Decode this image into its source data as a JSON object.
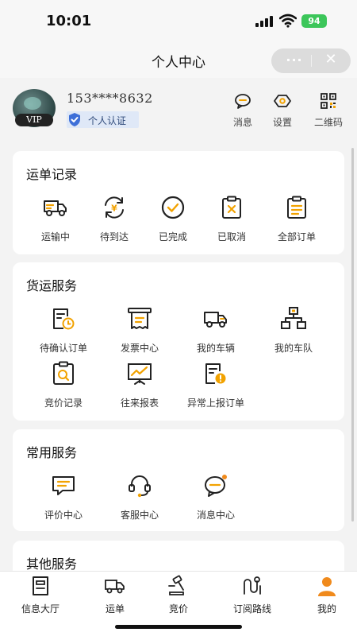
{
  "status_bar": {
    "time": "10:01",
    "battery": "94"
  },
  "nav": {
    "title": "个人中心",
    "more_label": "···",
    "close_label": "✕"
  },
  "profile": {
    "vip_badge": "VIP",
    "phone": "153****8632",
    "certification": "个人认证",
    "actions": [
      {
        "label": "消息",
        "icon": "message-icon"
      },
      {
        "label": "设置",
        "icon": "settings-icon"
      },
      {
        "label": "二维码",
        "icon": "qr-code-icon"
      }
    ]
  },
  "waybill_records": {
    "title": "运单记录",
    "items": [
      {
        "label": "运输中",
        "icon": "truck-icon"
      },
      {
        "label": "待到达",
        "icon": "yen-cycle-icon"
      },
      {
        "label": "已完成",
        "icon": "check-circle-icon"
      },
      {
        "label": "已取消",
        "icon": "clipboard-x-icon"
      },
      {
        "label": "全部订单",
        "icon": "clipboard-list-icon"
      }
    ]
  },
  "freight_services": {
    "title": "货运服务",
    "items": [
      {
        "label": "待确认订单",
        "icon": "pending-order-icon"
      },
      {
        "label": "发票中心",
        "icon": "invoice-icon"
      },
      {
        "label": "我的车辆",
        "icon": "vehicle-icon"
      },
      {
        "label": "我的车队",
        "icon": "fleet-icon"
      },
      {
        "label": "竞价记录",
        "icon": "bid-record-icon"
      },
      {
        "label": "往来报表",
        "icon": "report-chart-icon"
      },
      {
        "label": "异常上报订单",
        "icon": "exception-report-icon"
      }
    ]
  },
  "common_services": {
    "title": "常用服务",
    "items": [
      {
        "label": "评价中心",
        "icon": "review-icon"
      },
      {
        "label": "客服中心",
        "icon": "headset-icon"
      },
      {
        "label": "消息中心",
        "icon": "message-center-icon"
      }
    ]
  },
  "other_services": {
    "title": "其他服务"
  },
  "tabbar": {
    "active_index": 4,
    "tabs": [
      {
        "label": "信息大厅",
        "icon": "info-hall-icon"
      },
      {
        "label": "运单",
        "icon": "waybill-truck-icon"
      },
      {
        "label": "竞价",
        "icon": "bidding-icon"
      },
      {
        "label": "订阅路线",
        "icon": "route-icon"
      },
      {
        "label": "我的",
        "icon": "profile-icon"
      }
    ]
  },
  "colors": {
    "accent": "#f2a200",
    "icon_dark": "#222222",
    "cert_blue": "#3d6fd8",
    "active_orange": "#f08a1c"
  }
}
